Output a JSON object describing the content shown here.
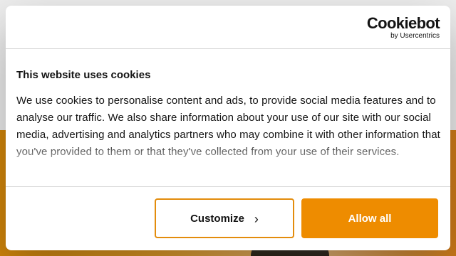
{
  "banner": {
    "logo": {
      "wordmark": "Cookiebot",
      "sub": "by Usercentrics"
    },
    "title": "This website uses cookies",
    "description": "We use cookies to personalise content and ads, to provide social media features and to analyse our traffic. We also share information about your use of our site with our social media, advertising and analytics partners who may combine it with other information that you've provided to them or that they've collected from your use of their services.",
    "buttons": {
      "customize_label": "Customize",
      "customize_icon": "chevron-right-icon",
      "allow_label": "Allow all"
    }
  },
  "colors": {
    "accent": "#ee8c00",
    "text": "#141414",
    "divider": "#d6d6d6"
  }
}
